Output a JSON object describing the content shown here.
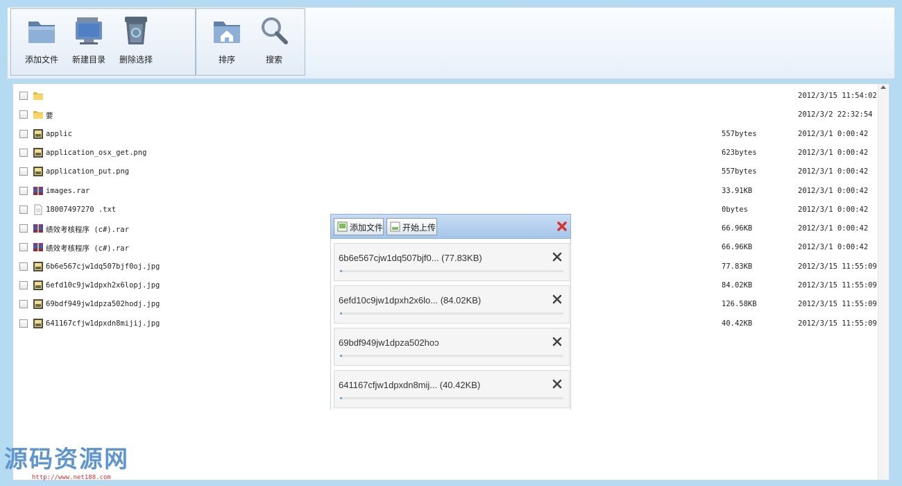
{
  "toolbar": {
    "add_file": "添加文件",
    "new_dir": "新建目录",
    "delete_selected": "删除选择",
    "sort": "排序",
    "search": "搜索"
  },
  "files": [
    {
      "name": "",
      "size": "",
      "date": "2012/3/15 11:54:02",
      "icon": "folder-icon"
    },
    {
      "name": "要",
      "size": "",
      "date": "2012/3/2 22:32:54",
      "icon": "folder-icon"
    },
    {
      "name": "applic",
      "size": "557bytes",
      "date": "2012/3/1 0:00:42",
      "icon": "image-file-icon"
    },
    {
      "name": "application_osx_get.png",
      "size": "623bytes",
      "date": "2012/3/1 0:00:42",
      "icon": "image-file-icon"
    },
    {
      "name": "application_put.png",
      "size": "557bytes",
      "date": "2012/3/1 0:00:42",
      "icon": "image-file-icon"
    },
    {
      "name": "images.rar",
      "size": "33.91KB",
      "date": "2012/3/1 0:00:42",
      "icon": "archive-file-icon"
    },
    {
      "name": "18007497270 .txt",
      "size": "0bytes",
      "date": "2012/3/1 0:00:42",
      "icon": "text-file-icon"
    },
    {
      "name": "绩效考核程序 (c#).rar",
      "size": "66.96KB",
      "date": "2012/3/1 0:00:42",
      "icon": "archive-file-icon"
    },
    {
      "name": "绩效考核程序 (c#).rar",
      "size": "66.96KB",
      "date": "2012/3/1 0:00:42",
      "icon": "archive-file-icon"
    },
    {
      "name": "6b6e567cjw1dq507bjf0oj.jpg",
      "size": "77.83KB",
      "date": "2012/3/15 11:55:09",
      "icon": "image-file-icon"
    },
    {
      "name": "6efd10c9jw1dpxh2x6lopj.jpg",
      "size": "84.02KB",
      "date": "2012/3/15 11:55:09",
      "icon": "image-file-icon"
    },
    {
      "name": "69bdf949jw1dpza502hodj.jpg",
      "size": "126.58KB",
      "date": "2012/3/15 11:55:09",
      "icon": "image-file-icon"
    },
    {
      "name": "641167cfjw1dpxdn8mijij.jpg",
      "size": "40.42KB",
      "date": "2012/3/15 11:55:09",
      "icon": "image-file-icon"
    }
  ],
  "upload_dialog": {
    "add_file_label": "添加文件",
    "start_upload_label": "开始上传",
    "items": [
      {
        "name": "6b6e567cjw1dq507bjf0... (77.83KB)",
        "progress": 0.01
      },
      {
        "name": "6efd10c9jw1dpxh2x6lo... (84.02KB)",
        "progress": 0.01
      },
      {
        "name": "69bdf949jw1dpza502hoɔ",
        "progress": 0.01
      },
      {
        "name": "641167cfjw1dpxdn8mij... (40.42KB)",
        "progress": 0.01
      }
    ]
  },
  "watermark": {
    "title": "源码资源网",
    "url": "http://www.net188.com"
  },
  "colors": {
    "frame": "#b5dbf3",
    "dialog_header": "#a6c6ea",
    "watermark": "#5f95cf",
    "close_red": "#d9322c"
  }
}
